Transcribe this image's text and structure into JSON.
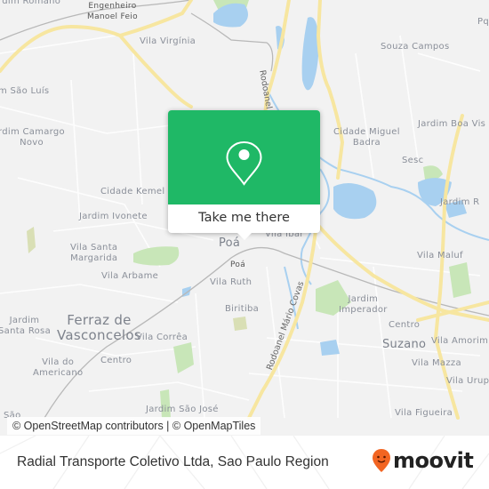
{
  "map": {
    "labels": [
      {
        "text": "rdim Romano",
        "cls": ""
      },
      {
        "text": "Engenheiro\nManoel Feio",
        "cls": "small"
      },
      {
        "text": "Vila Virgínia",
        "cls": ""
      },
      {
        "text": "Souza Campos",
        "cls": ""
      },
      {
        "text": "Pq",
        "cls": ""
      },
      {
        "text": "m São Luís",
        "cls": ""
      },
      {
        "text": "rdim Camargo\nNovo",
        "cls": ""
      },
      {
        "text": "Cidade Miguel\nBadra",
        "cls": ""
      },
      {
        "text": "Jardim Boa Vis",
        "cls": ""
      },
      {
        "text": "Sesc",
        "cls": ""
      },
      {
        "text": "Cidade Kemel",
        "cls": ""
      },
      {
        "text": "Jardim Ivonete",
        "cls": ""
      },
      {
        "text": "Jardim R",
        "cls": ""
      },
      {
        "text": "Vila Santa\nMargarida",
        "cls": ""
      },
      {
        "text": "Poá",
        "cls": "mid"
      },
      {
        "text": "Vila Ibar",
        "cls": ""
      },
      {
        "text": "Poá",
        "cls": "small"
      },
      {
        "text": "Vila Maluf",
        "cls": ""
      },
      {
        "text": "Vila Arbame",
        "cls": ""
      },
      {
        "text": "Vila Ruth",
        "cls": ""
      },
      {
        "text": "Biritiba",
        "cls": ""
      },
      {
        "text": "Jardim\nImperador",
        "cls": ""
      },
      {
        "text": "Centro",
        "cls": ""
      },
      {
        "text": "Jardim\nSanta Rosa",
        "cls": ""
      },
      {
        "text": "Ferraz de\nVasconcelos",
        "cls": "big"
      },
      {
        "text": "Vila Corrêa",
        "cls": ""
      },
      {
        "text": "Suzano",
        "cls": "mid"
      },
      {
        "text": "Vila Amorim",
        "cls": ""
      },
      {
        "text": "Vila do\nAmericano",
        "cls": ""
      },
      {
        "text": "Centro",
        "cls": ""
      },
      {
        "text": "Vila Mazza",
        "cls": ""
      },
      {
        "text": "Vila Urup",
        "cls": ""
      },
      {
        "text": "Jardim São José",
        "cls": ""
      },
      {
        "text": "Vila Figueira",
        "cls": ""
      },
      {
        "text": "São",
        "cls": ""
      }
    ],
    "road_labels": {
      "rodoanel_north": "Rodoanel",
      "rodoanel_south": "Rodoanel Mário Covas"
    },
    "colors": {
      "land": "#f2f2f2",
      "road_major": "#f7e6a0",
      "water": "#a8d0f0",
      "park": "#c8e6b8"
    },
    "attribution": "© OpenStreetMap contributors | © OpenMapTiles"
  },
  "popup": {
    "icon": "map-pin-icon",
    "button_label": "Take me there",
    "color": "#1fb866"
  },
  "footer": {
    "title": "Radial Transporte Coletivo Ltda, Sao Paulo Region",
    "brand": "moovit",
    "brand_icon": "moovit-pin-icon",
    "brand_color": "#f26522"
  }
}
